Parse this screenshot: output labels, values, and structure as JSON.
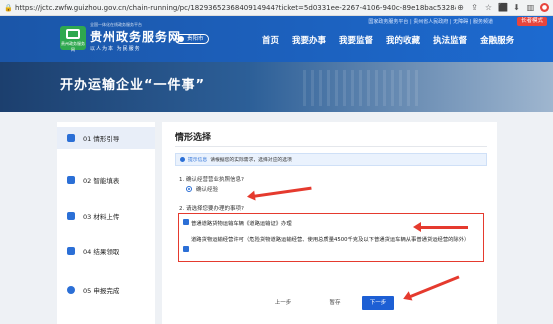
{
  "browser": {
    "url": "https://jctc.zwfw.guizhou.gov.cn/chain-running/pc/1829365236840914944?ticket=5d0331ee-2267-4106-940c-89e18bac5328&regionCod..."
  },
  "header": {
    "top_links": "国家政务服务平台 | 贵州省人民政府 | 无障碍 | 服务频道",
    "old_version_label": "长者模式",
    "logo_sub": "贵州政务服务网",
    "brand_small": "全国一体化在线政务服务平台",
    "brand_name": "贵州政务服务网",
    "brand_slogan": "以人为本 为民服务",
    "city": "贵阳市",
    "nav": [
      "首页",
      "我要办事",
      "我要监督",
      "我的收藏",
      "执法监督",
      "金融服务"
    ]
  },
  "banner": {
    "title": "开办运输企业“一件事”"
  },
  "steps": [
    {
      "label": "01 情形引导"
    },
    {
      "label": "02 智能填表"
    },
    {
      "label": "03 材料上传"
    },
    {
      "label": "04 结果领取"
    },
    {
      "label": "05 申报完成"
    }
  ],
  "content": {
    "title": "情形选择",
    "notice_tag": "提示信息",
    "notice_text": "请根据您的实际需求，选择对应的选项",
    "q1": "1. 确认经营营业执照信息?",
    "q1_option": "确认经验",
    "q2": "2. 请选择您要办理的事项?",
    "item1": "普通道路货物运输车辆《道路运输证》办理",
    "item2": "道路货物运输经营许可（危险货物道路运输经营、使用总质量4500千克及以下普通货运车辆从事普通货运经营的除外）",
    "btn_prev": "上一步",
    "btn_save": "暂存",
    "btn_next": "下一步"
  },
  "colors": {
    "accent": "#1d5fd4",
    "annotation": "#e53a2e"
  }
}
